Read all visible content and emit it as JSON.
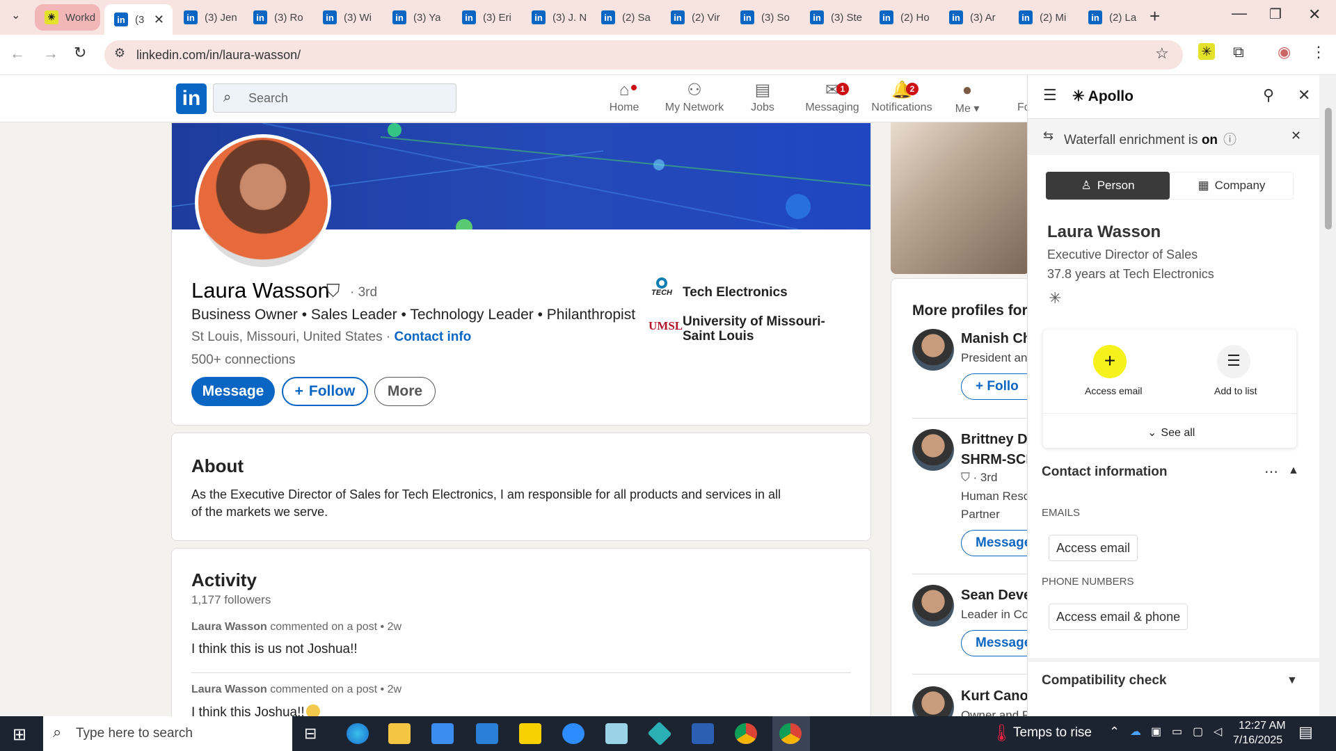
{
  "browser": {
    "tabs": [
      {
        "label": "Workd",
        "icon": "workday-icon"
      },
      {
        "label": "(3",
        "icon": "linkedin-icon"
      },
      {
        "label": "(3) Jen",
        "icon": "linkedin-icon"
      },
      {
        "label": "(3) Ro",
        "icon": "linkedin-icon"
      },
      {
        "label": "(3) Wi",
        "icon": "linkedin-icon"
      },
      {
        "label": "(3) Ya",
        "icon": "linkedin-icon"
      },
      {
        "label": "(3) Eri",
        "icon": "linkedin-icon"
      },
      {
        "label": "(3) J. N",
        "icon": "linkedin-icon"
      },
      {
        "label": "(2) Sa",
        "icon": "linkedin-icon"
      },
      {
        "label": "(2) Vir",
        "icon": "linkedin-icon"
      },
      {
        "label": "(3) So",
        "icon": "linkedin-icon"
      },
      {
        "label": "(3) Ste",
        "icon": "linkedin-icon"
      },
      {
        "label": "(2) Ho",
        "icon": "linkedin-icon"
      },
      {
        "label": "(3) Ar",
        "icon": "linkedin-icon"
      },
      {
        "label": "(2) Mi",
        "icon": "linkedin-icon"
      },
      {
        "label": "(2) La",
        "icon": "linkedin-icon"
      }
    ],
    "url": "linkedin.com/in/laura-wasson/"
  },
  "linkedin": {
    "search_placeholder": "Search",
    "nav": [
      {
        "label": "Home",
        "badge": "",
        "icon": "home-icon"
      },
      {
        "label": "My Network",
        "badge": "",
        "icon": "network-icon"
      },
      {
        "label": "Jobs",
        "badge": "",
        "icon": "briefcase-icon"
      },
      {
        "label": "Messaging",
        "badge": "1",
        "icon": "message-icon"
      },
      {
        "label": "Notifications",
        "badge": "2",
        "icon": "bell-icon"
      },
      {
        "label": "Me",
        "badge": "",
        "icon": "avatar"
      }
    ],
    "nav_cut": "Fo",
    "profile": {
      "name": "Laura Wasson",
      "degree": "· 3rd",
      "headline": "Business Owner • Sales Leader • Technology Leader • Philanthropist",
      "location": "St Louis, Missouri, United States",
      "location_sep": " · ",
      "contact_info": "Contact info",
      "connections": "500+ connections",
      "company": "Tech Electronics",
      "company_logo_text": "TECH",
      "school": "University of Missouri-Saint Louis",
      "school_logo_text": "UMSL",
      "buttons": {
        "message": "Message",
        "follow": "Follow",
        "more": "More"
      }
    },
    "about": {
      "title": "About",
      "text": "As the Executive Director of Sales for Tech Electronics, I am responsible for all products and services in all of the markets we serve."
    },
    "activity": {
      "title": "Activity",
      "followers": "1,177 followers",
      "items": [
        {
          "author": "Laura Wasson",
          "meta": " commented on a post • 2w",
          "text": "I think this is us not Joshua!!"
        },
        {
          "author": "Laura Wasson",
          "meta": " commented on a post • 2w",
          "text": "I think this Joshua!!"
        }
      ]
    },
    "more_profiles": {
      "title": "More profiles for y",
      "people": [
        {
          "name": "Manish Ch",
          "line1": "President an",
          "line2": "",
          "button": "Follo"
        },
        {
          "name": "Brittney Da",
          "line1": "SHRM-SCP",
          "line2": "· 3rd",
          "line3": "Human Reso",
          "line4": "Partner",
          "button": "Message"
        },
        {
          "name": "Sean Deve",
          "line1": "Leader in Co",
          "line2": "",
          "button": "Message"
        },
        {
          "name": "Kurt Canov",
          "line1": "Owner and F",
          "line2": "",
          "button": ""
        }
      ]
    }
  },
  "apollo": {
    "title": "Apollo",
    "banner": "Waterfall enrichment is ",
    "banner_state": "on",
    "tabs": {
      "person": "Person",
      "company": "Company"
    },
    "person": {
      "name": "Laura Wasson",
      "title": "Executive Director of Sales",
      "tenure": "37.8 years at Tech Electronics"
    },
    "actions": {
      "access_email": "Access email",
      "add_to_list": "Add to list",
      "see_all": "See all"
    },
    "contact": {
      "title": "Contact information",
      "emails_label": "EMAILS",
      "emails_button": "Access email",
      "phones_label": "PHONE NUMBERS",
      "phones_button": "Access email & phone"
    },
    "compat": "Compatibility check"
  },
  "taskbar": {
    "search_placeholder": "Type here to search",
    "weather": "Temps to rise",
    "time": "12:27 AM",
    "date": "7/16/2025"
  }
}
